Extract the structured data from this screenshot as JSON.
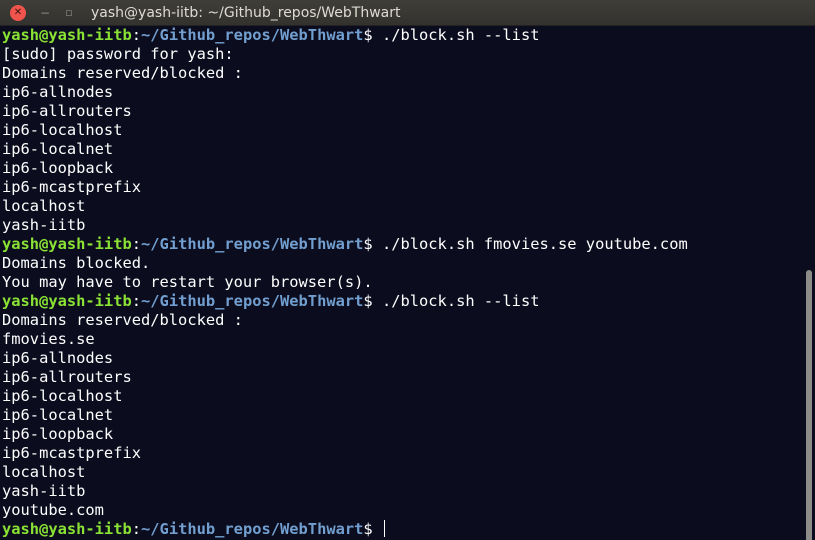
{
  "window": {
    "title": "yash@yash-iitb: ~/Github_repos/WebThwart",
    "close_label": "✕",
    "minimize_label": "−",
    "maximize_label": "▫"
  },
  "prompt": {
    "user_host": "yash@yash-iitb",
    "separator": ":",
    "path": "~/Github_repos/WebThwart",
    "symbol": "$ "
  },
  "terminal": {
    "lines": [
      {
        "type": "prompt",
        "command": "./block.sh --list"
      },
      {
        "type": "output",
        "text": "[sudo] password for yash:"
      },
      {
        "type": "output",
        "text": "Domains reserved/blocked :"
      },
      {
        "type": "output",
        "text": "ip6-allnodes"
      },
      {
        "type": "output",
        "text": "ip6-allrouters"
      },
      {
        "type": "output",
        "text": "ip6-localhost"
      },
      {
        "type": "output",
        "text": "ip6-localnet"
      },
      {
        "type": "output",
        "text": "ip6-loopback"
      },
      {
        "type": "output",
        "text": "ip6-mcastprefix"
      },
      {
        "type": "output",
        "text": "localhost"
      },
      {
        "type": "output",
        "text": "yash-iitb"
      },
      {
        "type": "prompt",
        "command": "./block.sh fmovies.se youtube.com"
      },
      {
        "type": "output",
        "text": "Domains blocked."
      },
      {
        "type": "output",
        "text": "You may have to restart your browser(s)."
      },
      {
        "type": "prompt",
        "command": "./block.sh --list"
      },
      {
        "type": "output",
        "text": "Domains reserved/blocked :"
      },
      {
        "type": "output",
        "text": "fmovies.se"
      },
      {
        "type": "output",
        "text": "ip6-allnodes"
      },
      {
        "type": "output",
        "text": "ip6-allrouters"
      },
      {
        "type": "output",
        "text": "ip6-localhost"
      },
      {
        "type": "output",
        "text": "ip6-localnet"
      },
      {
        "type": "output",
        "text": "ip6-loopback"
      },
      {
        "type": "output",
        "text": "ip6-mcastprefix"
      },
      {
        "type": "output",
        "text": "localhost"
      },
      {
        "type": "output",
        "text": "yash-iitb"
      },
      {
        "type": "output",
        "text": "youtube.com"
      },
      {
        "type": "prompt",
        "command": "",
        "cursor": true
      }
    ]
  },
  "colors": {
    "background": "#0b0c1e",
    "user_host": "#8ae234",
    "path": "#729fcf",
    "text": "#ffffff",
    "close_button": "#f0544c"
  }
}
